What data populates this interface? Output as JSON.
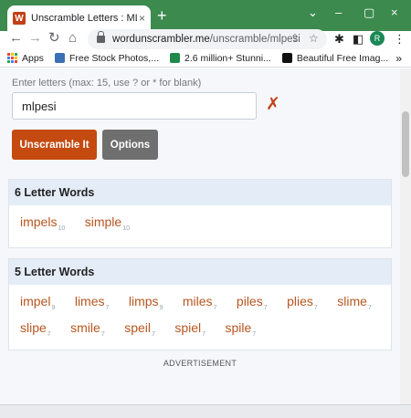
{
  "browser": {
    "tab_title": "Unscramble Letters : MLPESI To F",
    "tab_close": "×",
    "new_tab": "+",
    "favicon_letter": "W",
    "url_domain": "wordunscrambler.me",
    "url_path": "/unscramble/mlpesi",
    "avatar_letter": "R",
    "win_min": "⌄",
    "win_minimize": "–",
    "win_restore": "▢",
    "win_close": "×",
    "back": "←",
    "forward": "→",
    "reload": "↻",
    "home": "⌂",
    "share": "⇪",
    "star": "☆",
    "puzzle": "✱",
    "sidepanel": "◧",
    "menu": "⋮"
  },
  "bookmarks": {
    "items": [
      {
        "label": "Apps"
      },
      {
        "label": "Free Stock Photos,..."
      },
      {
        "label": "2.6 million+ Stunni..."
      },
      {
        "label": "Beautiful Free Imag..."
      }
    ],
    "more": "»"
  },
  "search": {
    "label": "Enter letters (max: 15, use ? or * for blank)",
    "value": "mlpesi",
    "clear": "✗",
    "unscramble_button": "Unscramble It",
    "options_button": "Options"
  },
  "sections": [
    {
      "title": "6 Letter Words",
      "words": [
        {
          "word": "impels",
          "score": "10"
        },
        {
          "word": "simple",
          "score": "10"
        }
      ]
    },
    {
      "title": "5 Letter Words",
      "words": [
        {
          "word": "impel",
          "score": "9"
        },
        {
          "word": "limes",
          "score": "7"
        },
        {
          "word": "limps",
          "score": "9"
        },
        {
          "word": "miles",
          "score": "7"
        },
        {
          "word": "piles",
          "score": "7"
        },
        {
          "word": "plies",
          "score": "7"
        },
        {
          "word": "slime",
          "score": "7"
        },
        {
          "word": "slipe",
          "score": "7"
        },
        {
          "word": "smile",
          "score": "7"
        },
        {
          "word": "speil",
          "score": "7"
        },
        {
          "word": "spiel",
          "score": "7"
        },
        {
          "word": "spile",
          "score": "7"
        }
      ]
    }
  ],
  "advertisement": "ADVERTISEMENT",
  "colors": {
    "tabstrip": "#3c8a4e",
    "accent": "#c44a10",
    "word": "#b7561f",
    "panel_head": "#e4ecf7"
  }
}
